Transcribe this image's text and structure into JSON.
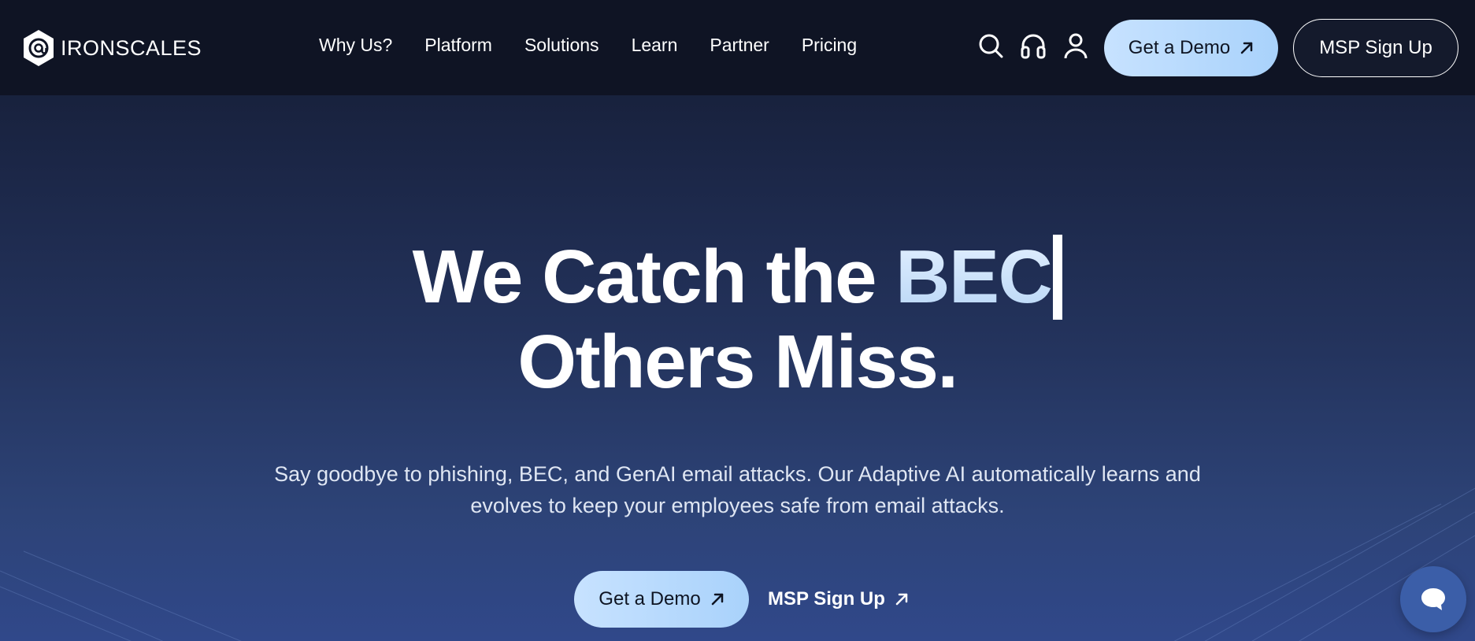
{
  "header": {
    "logo_text": "IRONSCALES",
    "nav": [
      "Why Us?",
      "Platform",
      "Solutions",
      "Learn",
      "Partner",
      "Pricing"
    ],
    "icons": [
      "search-icon",
      "headset-icon",
      "user-icon"
    ],
    "demo_label": "Get a Demo",
    "msp_label": "MSP Sign Up"
  },
  "hero": {
    "title_prefix": "We Catch the ",
    "title_accent": "BEC",
    "title_line2": "Others Miss.",
    "subtitle": "Say goodbye to phishing, BEC, and GenAI email attacks. Our Adaptive AI automatically learns and evolves to keep your employees safe from email attacks.",
    "demo_label": "Get a Demo",
    "msp_label": "MSP Sign Up"
  },
  "colors": {
    "header_bg": "#0f1424",
    "accent_button": "#b8dbfd",
    "accent_text": "#c8e1fb",
    "chat_bubble": "#3b5ea8"
  },
  "chat": {
    "icon": "chat-bubble-icon"
  }
}
